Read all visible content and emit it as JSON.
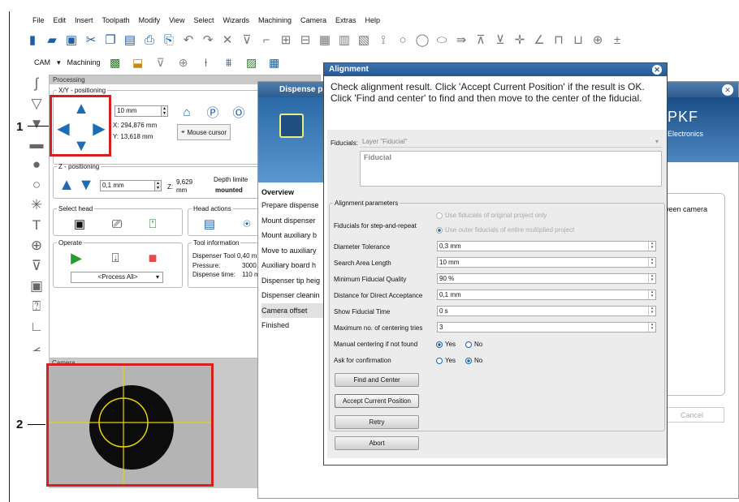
{
  "menu": [
    "File",
    "Edit",
    "Insert",
    "Toolpath",
    "Modify",
    "View",
    "Select",
    "Wizards",
    "Machining",
    "Camera",
    "Extras",
    "Help"
  ],
  "toolbar2": {
    "cam": "CAM",
    "machining": "Machining"
  },
  "callouts": {
    "one": "1",
    "two": "2"
  },
  "processing": {
    "title": "Processing",
    "xy": {
      "legend": "X/Y - positioning",
      "step": "10 mm",
      "x": "X: 294,876 mm",
      "y": "Y: 13,618 mm",
      "mouse_cursor": "Mouse cursor"
    },
    "z": {
      "legend": "Z - positioning",
      "step": "0,1 mm",
      "z_label": "Z:",
      "z_value": "9,629",
      "z_unit": "mm",
      "depth_limiter": "Depth limite",
      "mounted": "mounted"
    },
    "select_head": {
      "legend": "Select head"
    },
    "head_actions": {
      "legend": "Head actions"
    },
    "operate": {
      "legend": "Operate",
      "process": "<Process All>"
    },
    "tool_info": {
      "legend": "Tool information",
      "tool": "Dispenser Tool 0,40 m",
      "pressure_label": "Pressure:",
      "pressure_value": "3000",
      "disp_time_label": "Dispense time:",
      "disp_time_value": "110 m"
    }
  },
  "camera": {
    "title": "Camera"
  },
  "dispense": {
    "title": "Dispense p",
    "logo": "PKF",
    "logo_sub": "Electronics",
    "overview": "Overview",
    "steps": [
      "Prepare dispense",
      "Mount dispenser",
      "Mount auxiliary b",
      "Move to auxiliary",
      "Auxiliary board h",
      "Dispenser tip heig",
      "Dispenser cleanin",
      "Camera offset",
      "Finished"
    ],
    "right_text": "ween camera",
    "cancel": "Cancel"
  },
  "alignment": {
    "title": "Alignment",
    "message": "Check alignment result. Click 'Accept Current Position' if the result is OK. Click 'Find and center' to find and then move to the center of the fiducial.",
    "fiducials_label": "Fiducials:",
    "fiducials_value": "Layer \"Fiducial\"",
    "fiducial_list": "Fiducial",
    "params_legend": "Alignment parameters",
    "step_repeat_label": "Fiducials for step-and-repeat",
    "opt_original": "Use fiducials of original project only",
    "opt_outer": "Use outer fiducials of entire multiplied project",
    "fields": [
      {
        "label": "Diameter Tolerance",
        "value": "0,3 mm"
      },
      {
        "label": "Search Area Length",
        "value": "10 mm"
      },
      {
        "label": "Minimum Fiducial Quality",
        "value": "90 %"
      },
      {
        "label": "Distance for Direct Acceptance",
        "value": "0,1 mm"
      },
      {
        "label": "Show Fiducial Time",
        "value": "0 s"
      },
      {
        "label": "Maximum no. of centering tries",
        "value": "3"
      }
    ],
    "manual_label": "Manual centering if not found",
    "confirm_label": "Ask for confirmation",
    "yes": "Yes",
    "no": "No",
    "buttons": {
      "find": "Find and Center",
      "accept": "Accept Current Position",
      "retry": "Retry",
      "abort": "Abort"
    }
  }
}
